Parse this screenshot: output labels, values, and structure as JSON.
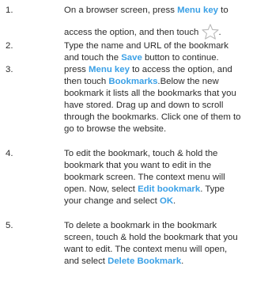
{
  "steps": [
    {
      "number": "1.",
      "line1_pre": "On a browser screen, press ",
      "line1_hl": "Menu key",
      "line1_post": " to",
      "line2_pre": "access the option, and then touch",
      "icon": "star-icon",
      "line2_post": "."
    },
    {
      "number": "2.",
      "pre": "Type the name and URL of the bookmark and touch the ",
      "hl": "Save",
      "post": " button to continue."
    },
    {
      "number": "3.",
      "pre": "press ",
      "hl1": "Menu key",
      "mid": " to access the option, and then touch ",
      "hl2": "Bookmarks",
      "post": ".Below the new bookmark it lists all the bookmarks that you have stored. Drag up and down to scroll through the bookmarks. Click one of them to go to browse the website."
    },
    {
      "number": "4.",
      "pre": "To edit the bookmark, touch & hold the bookmark that you want to edit in the bookmark screen. The context menu will open. Now, select ",
      "hl1": "Edit bookmark",
      "mid": ". Type your change and select ",
      "hl2": "OK",
      "post": "."
    },
    {
      "number": "5.",
      "pre": "To delete a bookmark in the bookmark screen, touch & hold the bookmark that you want to edit. The context menu will open, and select ",
      "hl": "Delete Bookmark",
      "post": "."
    }
  ],
  "colors": {
    "highlight": "#3aa0e6",
    "text": "#2b2b2b",
    "icon": "#b8b8b8"
  }
}
